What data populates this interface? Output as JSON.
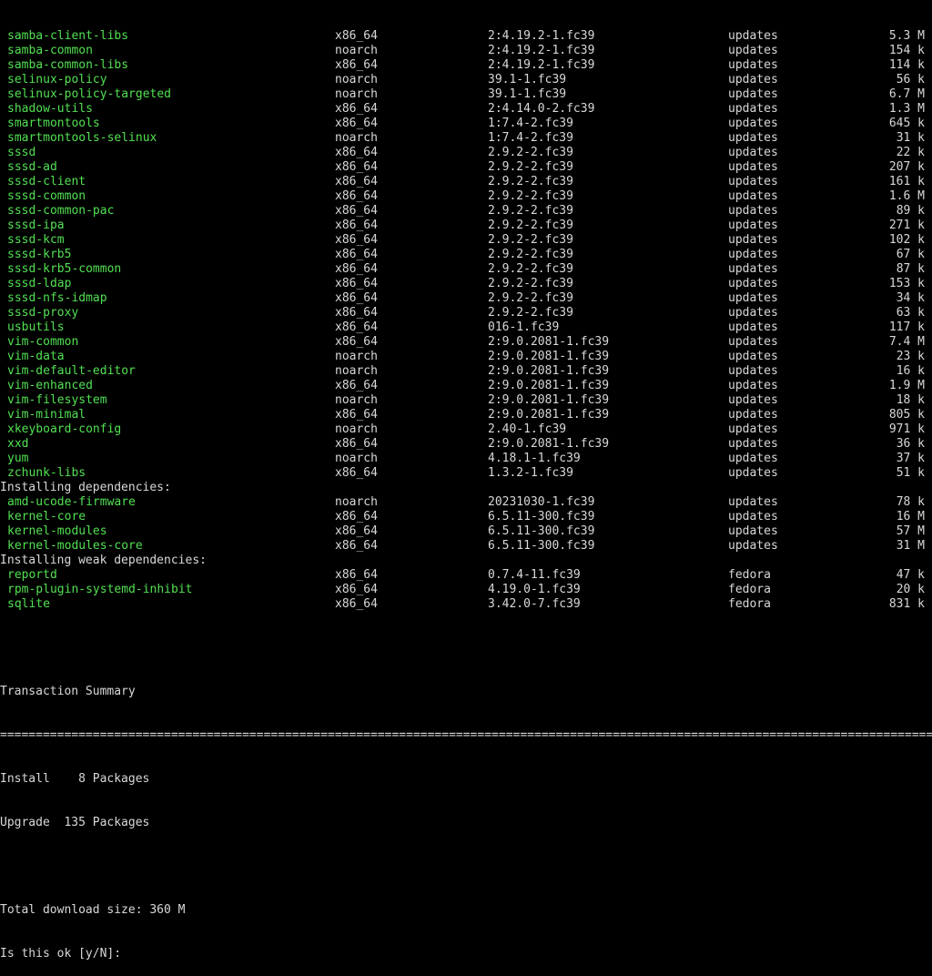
{
  "sections": [
    {
      "header": "",
      "packages": [
        {
          "name": "samba-client-libs",
          "arch": "x86_64",
          "version": "2:4.19.2-1.fc39",
          "repo": "updates",
          "size": "5.3 M"
        },
        {
          "name": "samba-common",
          "arch": "noarch",
          "version": "2:4.19.2-1.fc39",
          "repo": "updates",
          "size": "154 k"
        },
        {
          "name": "samba-common-libs",
          "arch": "x86_64",
          "version": "2:4.19.2-1.fc39",
          "repo": "updates",
          "size": "114 k"
        },
        {
          "name": "selinux-policy",
          "arch": "noarch",
          "version": "39.1-1.fc39",
          "repo": "updates",
          "size": "56 k"
        },
        {
          "name": "selinux-policy-targeted",
          "arch": "noarch",
          "version": "39.1-1.fc39",
          "repo": "updates",
          "size": "6.7 M"
        },
        {
          "name": "shadow-utils",
          "arch": "x86_64",
          "version": "2:4.14.0-2.fc39",
          "repo": "updates",
          "size": "1.3 M"
        },
        {
          "name": "smartmontools",
          "arch": "x86_64",
          "version": "1:7.4-2.fc39",
          "repo": "updates",
          "size": "645 k"
        },
        {
          "name": "smartmontools-selinux",
          "arch": "noarch",
          "version": "1:7.4-2.fc39",
          "repo": "updates",
          "size": "31 k"
        },
        {
          "name": "sssd",
          "arch": "x86_64",
          "version": "2.9.2-2.fc39",
          "repo": "updates",
          "size": "22 k"
        },
        {
          "name": "sssd-ad",
          "arch": "x86_64",
          "version": "2.9.2-2.fc39",
          "repo": "updates",
          "size": "207 k"
        },
        {
          "name": "sssd-client",
          "arch": "x86_64",
          "version": "2.9.2-2.fc39",
          "repo": "updates",
          "size": "161 k"
        },
        {
          "name": "sssd-common",
          "arch": "x86_64",
          "version": "2.9.2-2.fc39",
          "repo": "updates",
          "size": "1.6 M"
        },
        {
          "name": "sssd-common-pac",
          "arch": "x86_64",
          "version": "2.9.2-2.fc39",
          "repo": "updates",
          "size": "89 k"
        },
        {
          "name": "sssd-ipa",
          "arch": "x86_64",
          "version": "2.9.2-2.fc39",
          "repo": "updates",
          "size": "271 k"
        },
        {
          "name": "sssd-kcm",
          "arch": "x86_64",
          "version": "2.9.2-2.fc39",
          "repo": "updates",
          "size": "102 k"
        },
        {
          "name": "sssd-krb5",
          "arch": "x86_64",
          "version": "2.9.2-2.fc39",
          "repo": "updates",
          "size": "67 k"
        },
        {
          "name": "sssd-krb5-common",
          "arch": "x86_64",
          "version": "2.9.2-2.fc39",
          "repo": "updates",
          "size": "87 k"
        },
        {
          "name": "sssd-ldap",
          "arch": "x86_64",
          "version": "2.9.2-2.fc39",
          "repo": "updates",
          "size": "153 k"
        },
        {
          "name": "sssd-nfs-idmap",
          "arch": "x86_64",
          "version": "2.9.2-2.fc39",
          "repo": "updates",
          "size": "34 k"
        },
        {
          "name": "sssd-proxy",
          "arch": "x86_64",
          "version": "2.9.2-2.fc39",
          "repo": "updates",
          "size": "63 k"
        },
        {
          "name": "usbutils",
          "arch": "x86_64",
          "version": "016-1.fc39",
          "repo": "updates",
          "size": "117 k"
        },
        {
          "name": "vim-common",
          "arch": "x86_64",
          "version": "2:9.0.2081-1.fc39",
          "repo": "updates",
          "size": "7.4 M"
        },
        {
          "name": "vim-data",
          "arch": "noarch",
          "version": "2:9.0.2081-1.fc39",
          "repo": "updates",
          "size": "23 k"
        },
        {
          "name": "vim-default-editor",
          "arch": "noarch",
          "version": "2:9.0.2081-1.fc39",
          "repo": "updates",
          "size": "16 k"
        },
        {
          "name": "vim-enhanced",
          "arch": "x86_64",
          "version": "2:9.0.2081-1.fc39",
          "repo": "updates",
          "size": "1.9 M"
        },
        {
          "name": "vim-filesystem",
          "arch": "noarch",
          "version": "2:9.0.2081-1.fc39",
          "repo": "updates",
          "size": "18 k"
        },
        {
          "name": "vim-minimal",
          "arch": "x86_64",
          "version": "2:9.0.2081-1.fc39",
          "repo": "updates",
          "size": "805 k"
        },
        {
          "name": "xkeyboard-config",
          "arch": "noarch",
          "version": "2.40-1.fc39",
          "repo": "updates",
          "size": "971 k"
        },
        {
          "name": "xxd",
          "arch": "x86_64",
          "version": "2:9.0.2081-1.fc39",
          "repo": "updates",
          "size": "36 k"
        },
        {
          "name": "yum",
          "arch": "noarch",
          "version": "4.18.1-1.fc39",
          "repo": "updates",
          "size": "37 k"
        },
        {
          "name": "zchunk-libs",
          "arch": "x86_64",
          "version": "1.3.2-1.fc39",
          "repo": "updates",
          "size": "51 k"
        }
      ]
    },
    {
      "header": "Installing dependencies:",
      "packages": [
        {
          "name": "amd-ucode-firmware",
          "arch": "noarch",
          "version": "20231030-1.fc39",
          "repo": "updates",
          "size": "78 k"
        },
        {
          "name": "kernel-core",
          "arch": "x86_64",
          "version": "6.5.11-300.fc39",
          "repo": "updates",
          "size": "16 M"
        },
        {
          "name": "kernel-modules",
          "arch": "x86_64",
          "version": "6.5.11-300.fc39",
          "repo": "updates",
          "size": "57 M"
        },
        {
          "name": "kernel-modules-core",
          "arch": "x86_64",
          "version": "6.5.11-300.fc39",
          "repo": "updates",
          "size": "31 M"
        }
      ]
    },
    {
      "header": "Installing weak dependencies:",
      "packages": [
        {
          "name": "reportd",
          "arch": "x86_64",
          "version": "0.7.4-11.fc39",
          "repo": "fedora",
          "size": "47 k"
        },
        {
          "name": "rpm-plugin-systemd-inhibit",
          "arch": "x86_64",
          "version": "4.19.0-1.fc39",
          "repo": "fedora",
          "size": "20 k"
        },
        {
          "name": "sqlite",
          "arch": "x86_64",
          "version": "3.42.0-7.fc39",
          "repo": "fedora",
          "size": "831 k"
        }
      ]
    }
  ],
  "summary": {
    "title": "Transaction Summary",
    "separator": "============================================================================================================================================================",
    "install_line": "Install    8 Packages",
    "upgrade_line": "Upgrade  135 Packages",
    "download_line": "Total download size: 360 M",
    "prompt": "Is this ok [y/N]: "
  },
  "colors": {
    "background": "#000000",
    "text": "#d8d8d8",
    "package_name": "#52e052"
  }
}
